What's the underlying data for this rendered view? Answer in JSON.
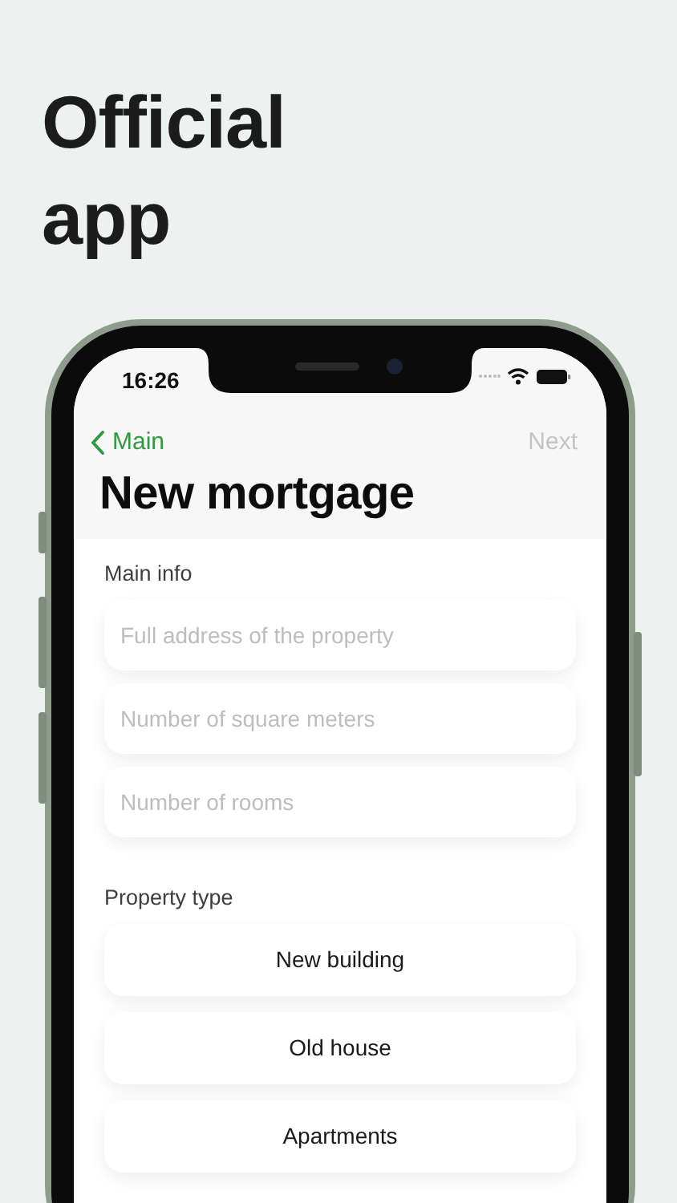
{
  "headline": "Official app",
  "status_bar": {
    "time": "16:26"
  },
  "nav": {
    "back_label": "Main",
    "next_label": "Next",
    "next_disabled": true
  },
  "title": "New mortgage",
  "sections": [
    {
      "kind": "fields",
      "label": "Main info",
      "fields": [
        {
          "placeholder": "Full address of the property"
        },
        {
          "placeholder": "Number of square meters"
        },
        {
          "placeholder": "Number of rooms"
        }
      ]
    },
    {
      "kind": "options",
      "label": "Property type",
      "options": [
        {
          "label": "New building"
        },
        {
          "label": "Old house"
        },
        {
          "label": "Apartments"
        }
      ]
    }
  ]
}
